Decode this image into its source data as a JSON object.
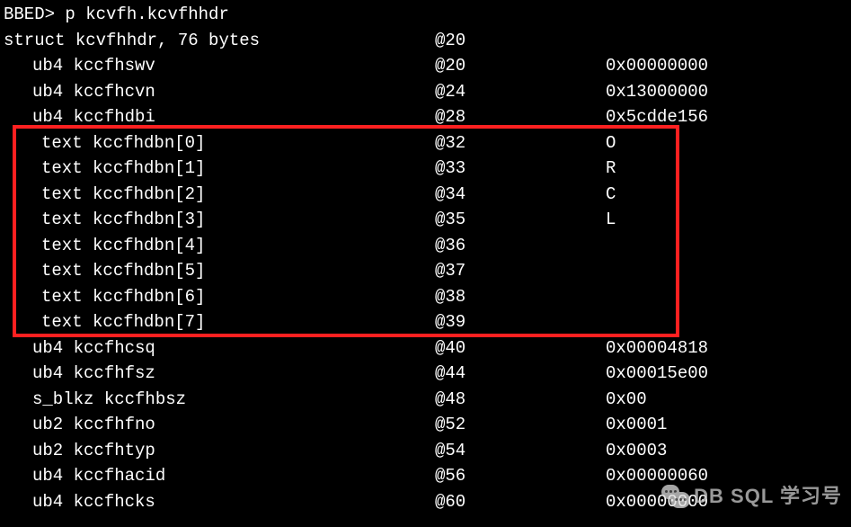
{
  "prompt": "BBED> ",
  "command": "p kcvfh.kcvfhhdr",
  "struct_header": {
    "name": "struct kcvfhhdr, 76 bytes",
    "offset": "@20",
    "value": ""
  },
  "rows": [
    {
      "name": "ub4 kccfhswv",
      "offset": "@20",
      "value": "0x00000000",
      "hi": false
    },
    {
      "name": "ub4 kccfhcvn",
      "offset": "@24",
      "value": "0x13000000",
      "hi": false
    },
    {
      "name": "ub4 kccfhdbi",
      "offset": "@28",
      "value": "0x5cdde156",
      "hi": false
    },
    {
      "name": "text kccfhdbn[0]",
      "offset": "@32",
      "value": "O",
      "hi": true
    },
    {
      "name": "text kccfhdbn[1]",
      "offset": "@33",
      "value": "R",
      "hi": true
    },
    {
      "name": "text kccfhdbn[2]",
      "offset": "@34",
      "value": "C",
      "hi": true
    },
    {
      "name": "text kccfhdbn[3]",
      "offset": "@35",
      "value": "L",
      "hi": true
    },
    {
      "name": "text kccfhdbn[4]",
      "offset": "@36",
      "value": "",
      "hi": true
    },
    {
      "name": "text kccfhdbn[5]",
      "offset": "@37",
      "value": "",
      "hi": true
    },
    {
      "name": "text kccfhdbn[6]",
      "offset": "@38",
      "value": "",
      "hi": true
    },
    {
      "name": "text kccfhdbn[7]",
      "offset": "@39",
      "value": "",
      "hi": true
    },
    {
      "name": "ub4 kccfhcsq",
      "offset": "@40",
      "value": "0x00004818",
      "hi": false
    },
    {
      "name": "ub4 kccfhfsz",
      "offset": "@44",
      "value": "0x00015e00",
      "hi": false
    },
    {
      "name": "s_blkz kccfhbsz",
      "offset": "@48",
      "value": "0x00",
      "hi": false
    },
    {
      "name": "ub2 kccfhfno",
      "offset": "@52",
      "value": "0x0001",
      "hi": false
    },
    {
      "name": "ub2 kccfhtyp",
      "offset": "@54",
      "value": "0x0003",
      "hi": false
    },
    {
      "name": "ub4 kccfhacid",
      "offset": "@56",
      "value": "0x00000060",
      "hi": false
    },
    {
      "name": "ub4 kccfhcks",
      "offset": "@60",
      "value": "0x00000000",
      "hi": false
    }
  ],
  "watermark_text": "DB SQL 学习号"
}
